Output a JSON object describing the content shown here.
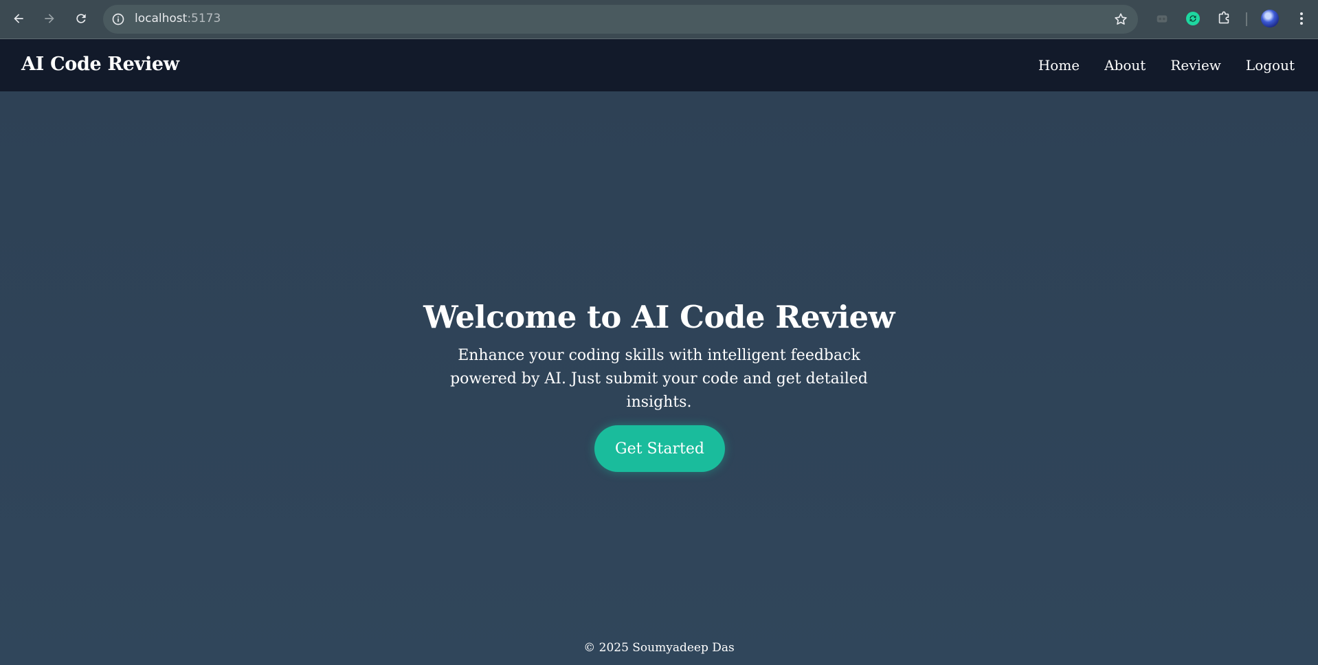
{
  "browser": {
    "url_host": "localhost",
    "url_port": ":5173",
    "accent_ext_color": "#1abc9c"
  },
  "app": {
    "brand": "AI Code Review",
    "nav": {
      "home": "Home",
      "about": "About",
      "review": "Review",
      "logout": "Logout"
    }
  },
  "hero": {
    "title": "Welcome to AI Code Review",
    "subtitle": "Enhance your coding skills with intelligent feedback powered by AI. Just submit your code and get detailed insights.",
    "cta_label": "Get Started",
    "cta_color": "#1abc9c"
  },
  "footer": {
    "text": "© 2025 Soumyadeep Das"
  },
  "icons": [
    "back-arrow-icon",
    "forward-arrow-icon",
    "reload-icon",
    "site-info-icon",
    "bookmark-star-icon",
    "extension-muted-icon",
    "extension-sync-icon",
    "extensions-puzzle-icon",
    "profile-avatar",
    "browser-menu-icon"
  ]
}
